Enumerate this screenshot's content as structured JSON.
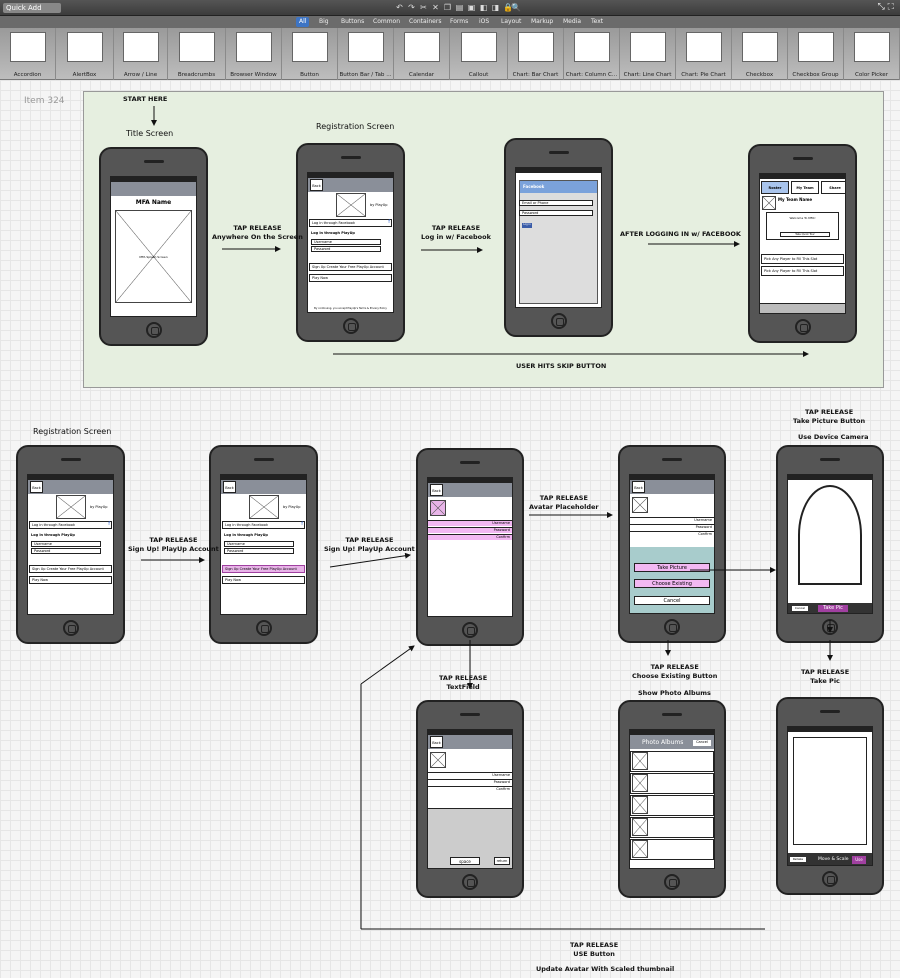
{
  "topbar": {
    "quick_add": "Quick Add"
  },
  "tabs": [
    "All",
    "Big",
    "Buttons",
    "Common",
    "Containers",
    "Forms",
    "iOS",
    "Layout",
    "Markup",
    "Media",
    "Text"
  ],
  "library": [
    "Accordion",
    "AlertBox",
    "Arrow / Line",
    "Breadcrumbs",
    "Browser Window",
    "Button",
    "Button Bar / Tab ...",
    "Calendar",
    "Callout",
    "Chart: Bar Chart",
    "Chart: Column C...",
    "Chart: Line Chart",
    "Chart: Pie Chart",
    "Checkbox",
    "Checkbox Group",
    "Color Picker"
  ],
  "item_label": "Item 324",
  "annotations": {
    "start": "START HERE",
    "title_screen": "Title Screen",
    "reg1": "Registration Screen",
    "tap1": "TAP RELEASE\nAnywhere On the Screen",
    "tap2": "TAP RELEASE\nLog in w/ Facebook",
    "after_fb": "AFTER LOGGING IN w/ FACEBOOK",
    "skip": "USER HITS SKIP BUTTON",
    "reg2": "Registration Screen",
    "tap3": "TAP RELEASE\nSign Up! PlayUp Account",
    "tap4": "TAP RELEASE\nSign Up! PlayUp Account",
    "tap_avatar": "TAP RELEASE\nAvatar Placeholder",
    "tap_takepic": "TAP RELEASE\nTake Picture Button",
    "use_camera": "Use Device Camera",
    "tap_textfield": "TAP RELEASE\nTextField",
    "tap_choose": "TAP RELEASE\nChoose Existing Button",
    "show_albums": "Show Photo Albums",
    "tap_takepic2": "TAP RELEASE\nTake Pic",
    "tap_use": "TAP RELEASE\nUSE Button",
    "update_avatar": "Update Avatar With Scaled thumbnail"
  },
  "screens": {
    "mfa_name": "MFA Name",
    "splash": "MFA Splash Screen",
    "back": "Back",
    "logo": "MFA LOGO",
    "by": "by PlayUp",
    "fb_login": "Log in through Facebook",
    "playup_login": "Log in through PlayUp",
    "username": "Username",
    "password": "Password",
    "signup": "Sign Up Create Your Free PlayUp Account",
    "play_now": "Play Now",
    "terms": "By continuing, you accept PlayUp's Terms & Privacy Policy",
    "facebook": "Facebook",
    "email": "Email or Phone",
    "login": "Log in",
    "roster": "Roster",
    "my_team": "My Team",
    "share": "Share",
    "my_team_name": "My Team Name",
    "welcome": "Welcome To MFA!",
    "take_tour": "Take Quick Tour",
    "pick_player": "Pick Any Player to Fill This Slot",
    "confirm": "Confirm",
    "take_picture": "Take Picture",
    "choose_existing": "Choose Existing",
    "cancel": "Cancel",
    "take_pic": "Take Pic",
    "photo_albums": "Photo Albums",
    "move_scale": "Move & Scale",
    "retake": "Retake",
    "use": "Use",
    "space": "space",
    "return": "return"
  }
}
